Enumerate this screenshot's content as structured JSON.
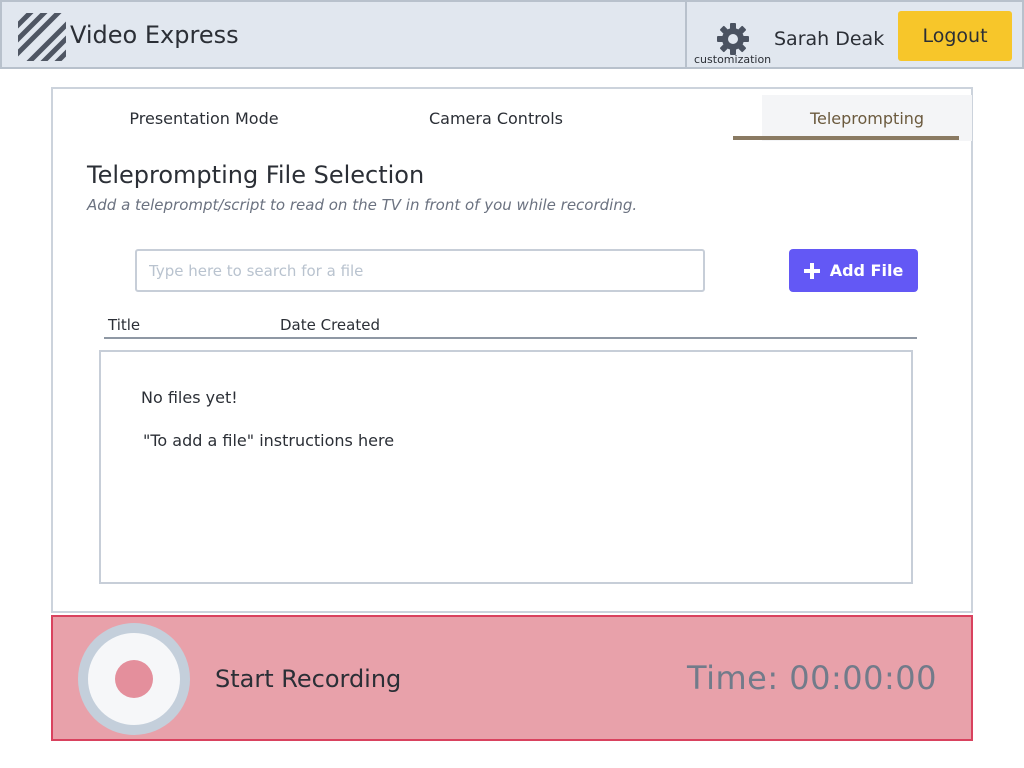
{
  "header": {
    "app_title": "Video Express",
    "settings_label": "customization",
    "user_name": "Sarah Deak",
    "logout_label": "Logout"
  },
  "tabs": [
    {
      "label": "Presentation Mode",
      "active": false
    },
    {
      "label": "Camera Controls",
      "active": false
    },
    {
      "label": "Teleprompting",
      "active": true
    }
  ],
  "section": {
    "title": "Teleprompting File Selection",
    "subtitle": "Add a teleprompt/script to read on the TV in front of you while recording."
  },
  "search": {
    "placeholder": "Type here to search for a file",
    "value": ""
  },
  "add_file": {
    "label": "Add File"
  },
  "table": {
    "columns": [
      "Title",
      "Date Created"
    ],
    "empty_title": "No files yet!",
    "empty_instructions": "\"To add a file\" instructions here"
  },
  "recording": {
    "label": "Start Recording",
    "time": "Time: 00:00:00"
  },
  "colors": {
    "header_bg": "#e1e7ef",
    "logout_bg": "#f7c62a",
    "add_file_bg": "#6358f5",
    "active_tab_accent": "#8a7a62",
    "record_bar_bg": "#e8a1aa",
    "record_bar_border": "#d9425e",
    "record_dot": "#e48f9c"
  },
  "icons": {
    "logo": "striped-logo-icon",
    "settings": "gear-icon",
    "add": "plus-icon",
    "record": "record-icon"
  }
}
